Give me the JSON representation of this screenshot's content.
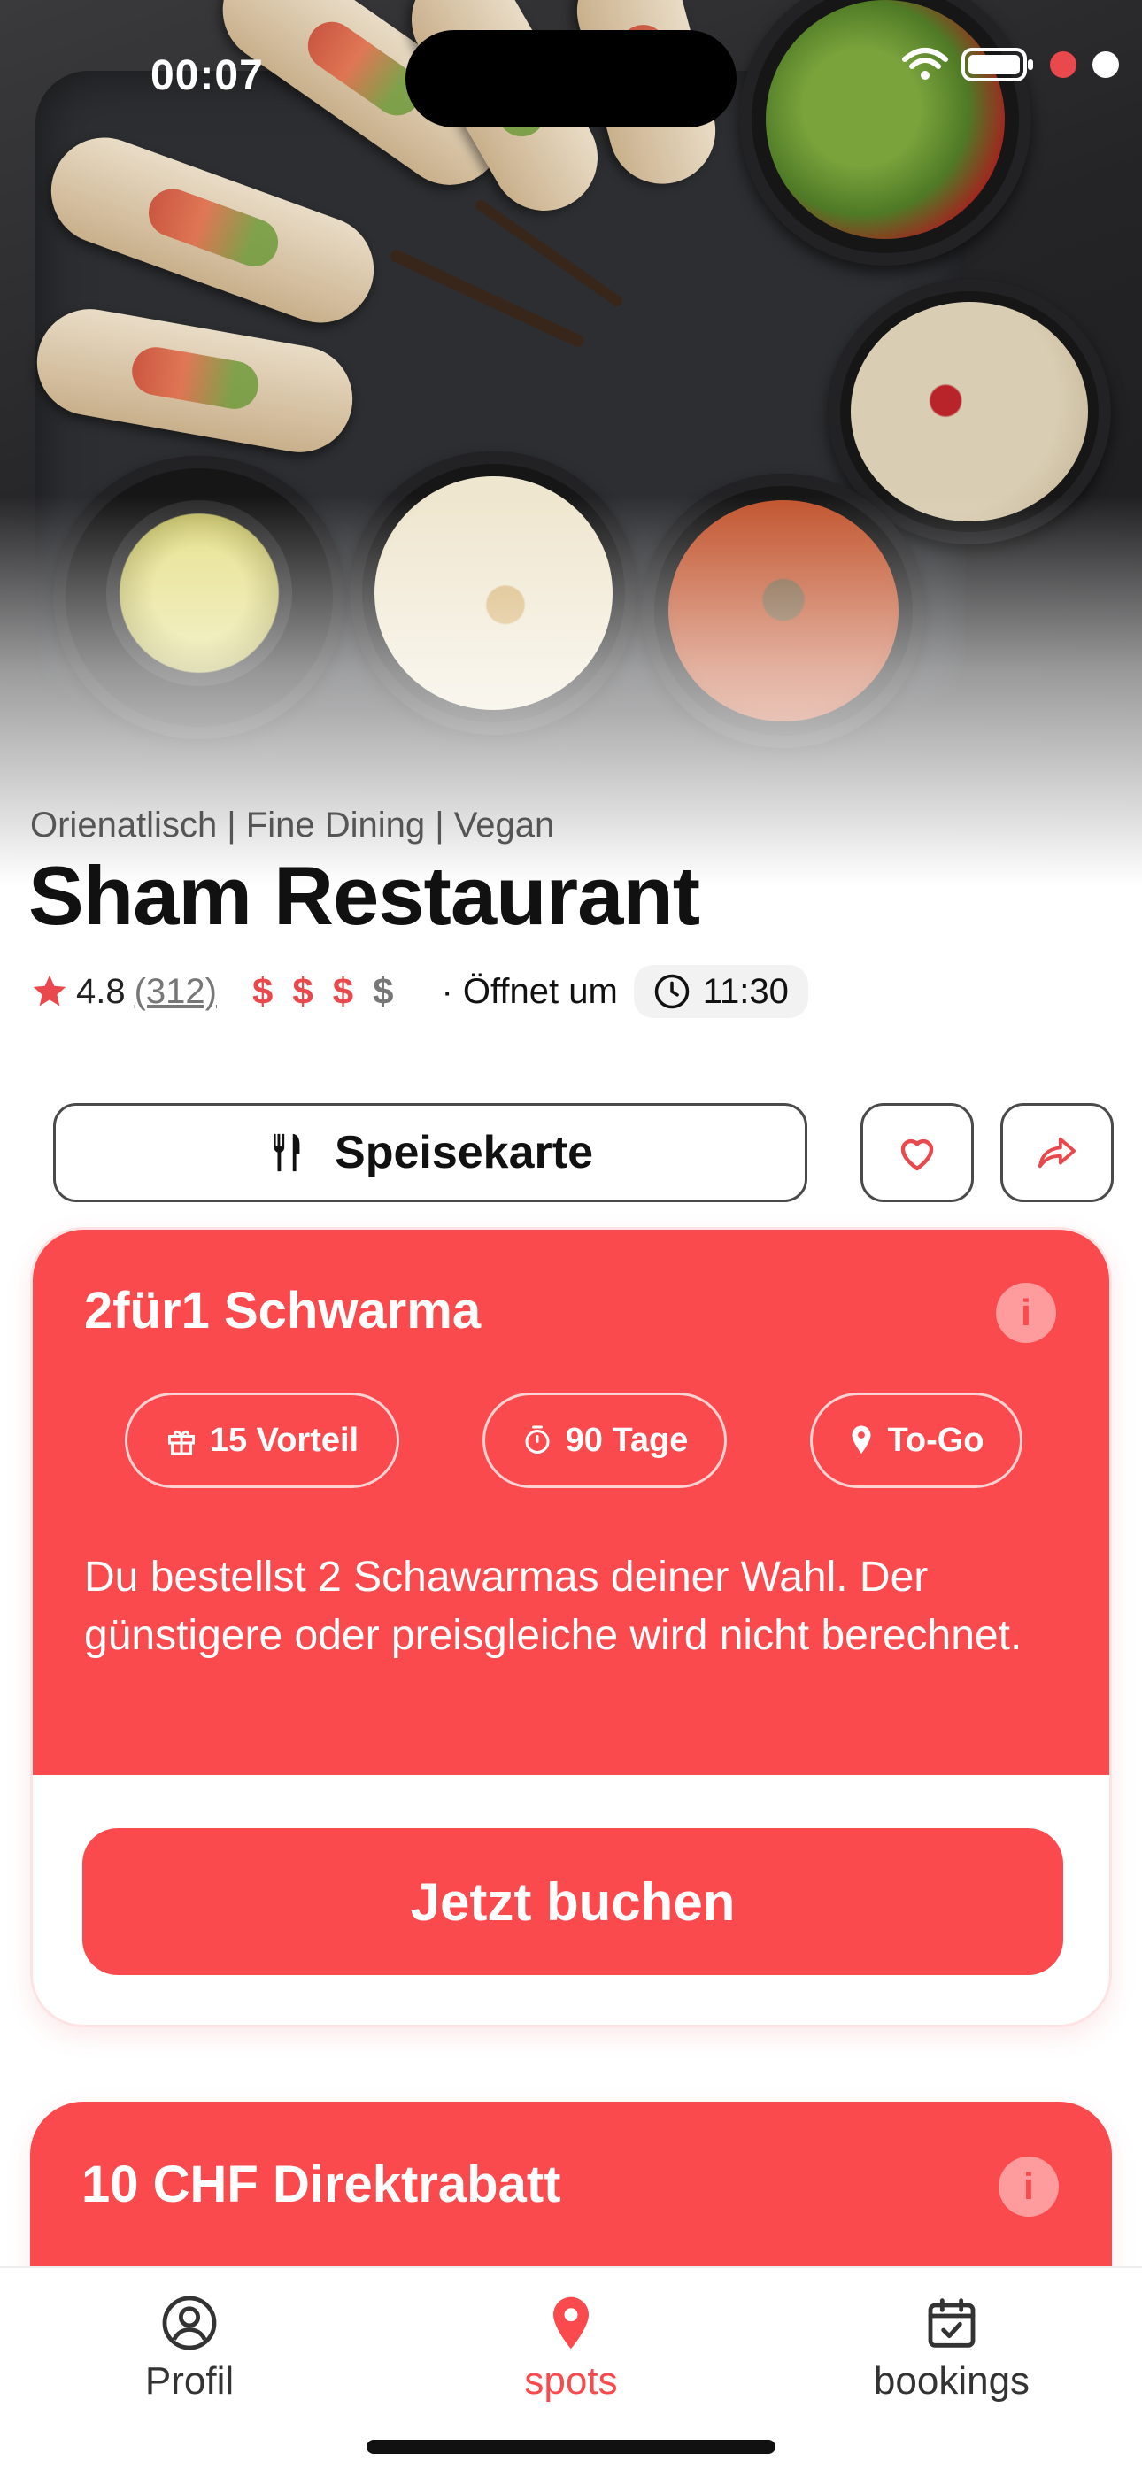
{
  "status_bar": {
    "time": "00:07"
  },
  "restaurant": {
    "categories": "Orienatlisch | Fine Dining | Vegan",
    "name": "Sham Restaurant",
    "rating": "4.8",
    "reviews": "(312)",
    "price_symbols": [
      "$",
      "$",
      "$",
      "$"
    ],
    "price_level": 3,
    "opens_label": "· Öffnet um",
    "opens_time": "11:30"
  },
  "actions": {
    "menu_label": "Speisekarte",
    "favorite_icon": "heart-icon",
    "share_icon": "share-icon"
  },
  "offers": [
    {
      "title": "2für1 Schwarma",
      "info": "i",
      "chips": [
        {
          "icon": "gift-icon",
          "label": "15 Vorteil"
        },
        {
          "icon": "timer-icon",
          "label": "90 Tage"
        },
        {
          "icon": "location-pin-icon",
          "label": "To-Go"
        }
      ],
      "description": "Du bestellst 2 Schawarmas deiner Wahl. Der günstigere oder preisgleiche wird nicht berechnet.",
      "cta": "Jetzt buchen"
    },
    {
      "title": "10 CHF Direktrabatt",
      "info": "i"
    }
  ],
  "bottom_nav": [
    {
      "label": "Profil",
      "icon": "user-circle-icon",
      "active": false
    },
    {
      "label": "spots",
      "icon": "location-pin-icon",
      "active": true
    },
    {
      "label": "bookings",
      "icon": "calendar-check-icon",
      "active": false
    }
  ],
  "colors": {
    "accent": "#fb4a4e",
    "text": "#111111",
    "muted": "#555555"
  }
}
